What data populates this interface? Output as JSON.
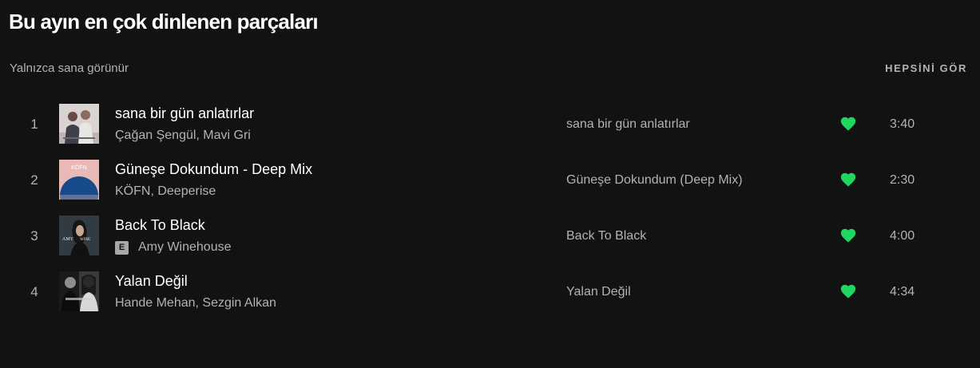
{
  "section": {
    "title": "Bu ayın en çok dinlenen parçaları",
    "subtitle": "Yalnızca sana görünür",
    "see_all_label": "HEPSİNİ GÖR"
  },
  "colors": {
    "background": "#121212",
    "text_primary": "#ffffff",
    "text_secondary": "#b3b3b3",
    "liked_heart": "#1ed760"
  },
  "tracks": [
    {
      "index": "1",
      "title": "sana bir gün anlatırlar",
      "artists": "Çağan Şengül, Mavi Gri",
      "explicit": false,
      "album": "sana bir gün anlatırlar",
      "duration": "3:40",
      "liked": true,
      "cover_icon": "album-cover-photo"
    },
    {
      "index": "2",
      "title": "Güneşe Dokundum - Deep Mix",
      "artists": "KÖFN, Deeperise",
      "explicit": false,
      "album": "Güneşe Dokundum (Deep Mix)",
      "duration": "2:30",
      "liked": true,
      "cover_icon": "album-cover-sun",
      "cover_text": "KÖFN"
    },
    {
      "index": "3",
      "title": "Back To Black",
      "artists": "Amy Winehouse",
      "explicit": true,
      "explicit_label": "E",
      "album": "Back To Black",
      "duration": "4:00",
      "liked": true,
      "cover_icon": "album-cover-portrait"
    },
    {
      "index": "4",
      "title": "Yalan Değil",
      "artists": "Hande Mehan, Sezgin Alkan",
      "explicit": false,
      "album": "Yalan Değil",
      "duration": "4:34",
      "liked": true,
      "cover_icon": "album-cover-bw-photo"
    }
  ]
}
